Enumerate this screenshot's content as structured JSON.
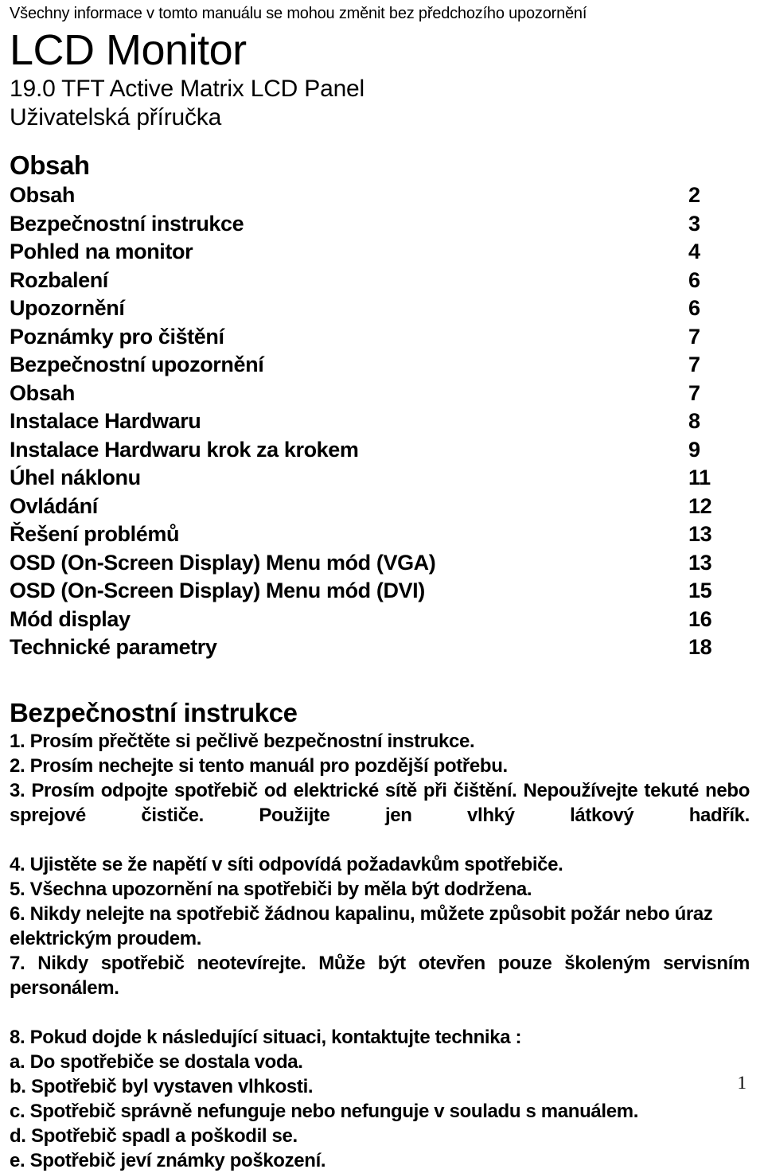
{
  "document": {
    "disclaimer": "Všechny informace v tomto manuálu se mohou změnit bez předchozího upozornění",
    "title": "LCD Monitor",
    "subtitle_line1": "19.0 TFT Active Matrix LCD Panel",
    "subtitle_line2": "Uživatelská příručka",
    "page_number": "1"
  },
  "toc": {
    "heading": "Obsah",
    "entries": [
      {
        "label": "Obsah",
        "page": "2"
      },
      {
        "label": "Bezpečnostní instrukce",
        "page": "3"
      },
      {
        "label": "Pohled na monitor",
        "page": "4"
      },
      {
        "label": "Rozbalení",
        "page": "6"
      },
      {
        "label": "Upozornění",
        "page": "6"
      },
      {
        "label": "Poznámky pro čištění",
        "page": "7"
      },
      {
        "label": "Bezpečnostní upozornění",
        "page": "7"
      },
      {
        "label": "Obsah",
        "page": "7"
      },
      {
        "label": "Instalace Hardwaru",
        "page": "8"
      },
      {
        "label": "Instalace Hardwaru krok za krokem",
        "page": "9"
      },
      {
        "label": "Úhel náklonu",
        "page": "11"
      },
      {
        "label": "Ovládání",
        "page": "12"
      },
      {
        "label": "Řešení problémů",
        "page": "13"
      },
      {
        "label": "OSD (On-Screen Display) Menu mód (VGA)",
        "page": "13"
      },
      {
        "label": "OSD (On-Screen Display) Menu mód (DVI)",
        "page": "15"
      },
      {
        "label": "Mód display",
        "page": "16"
      },
      {
        "label": "Technické parametry",
        "page": "18"
      }
    ]
  },
  "safety": {
    "heading": "Bezpečnostní instrukce",
    "items": [
      "1. Prosím přečtěte si pečlivě bezpečnostní instrukce.",
      "2. Prosím nechejte si tento manuál pro pozdější potřebu.",
      "3. Prosím odpojte spotřebič od elektrické sítě  při čištění. Nepoužívejte tekuté nebo sprejové čističe. Použijte jen vlhký látkový hadřík.",
      "4. Ujistěte se že napětí v síti odpovídá požadavkům spotřebiče.",
      "5. Všechna upozornění na spotřebiči by měla být dodržena.",
      "6. Nikdy nelejte na spotřebič žádnou kapalinu, můžete způsobit požár nebo úraz elektrickým proudem.",
      "7. Nikdy spotřebič neotevírejte. Může být otevřen pouze školeným servisním personálem.",
      "8. Pokud dojde k následující situaci, kontaktujte technika :"
    ],
    "sub_items": [
      "a. Do spotřebiče se dostala voda.",
      "b. Spotřebič byl vystaven vlhkosti.",
      "c. Spotřebič správně nefunguje nebo nefunguje v souladu s manuálem.",
      "d. Spotřebič spadl a poškodil se.",
      "e. Spotřebič jeví známky poškození."
    ]
  }
}
